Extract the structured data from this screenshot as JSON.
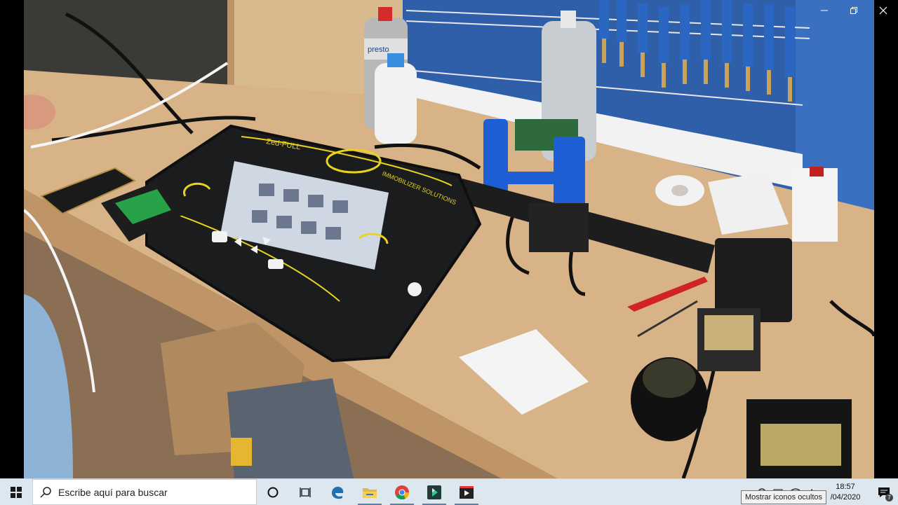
{
  "window": {
    "buttons": [
      {
        "name": "minimize-button",
        "icon": "minimize-icon"
      },
      {
        "name": "maximize-button",
        "icon": "maximize-icon"
      },
      {
        "name": "close-button",
        "icon": "close-icon"
      }
    ]
  },
  "photo": {
    "device_brand": "Zed-FULL",
    "device_maker": "IMMOBILIZER SOLUTIONS",
    "can_label": "presto"
  },
  "taskbar": {
    "search_placeholder": "Escribe aquí para buscar",
    "apps": [
      "cortana-icon",
      "task-view-icon",
      "edge-icon",
      "file-explorer-icon",
      "chrome-icon",
      "media-player-icon",
      "video-editor-icon"
    ],
    "clock_time": "18:57",
    "clock_date": "/04/2020",
    "tooltip": "Mostrar iconos ocultos",
    "notification_count": "7"
  },
  "colors": {
    "taskbar_bg": "#dde7ef",
    "accent": "#1f6fb5",
    "device_yellow": "#e8d31f"
  }
}
